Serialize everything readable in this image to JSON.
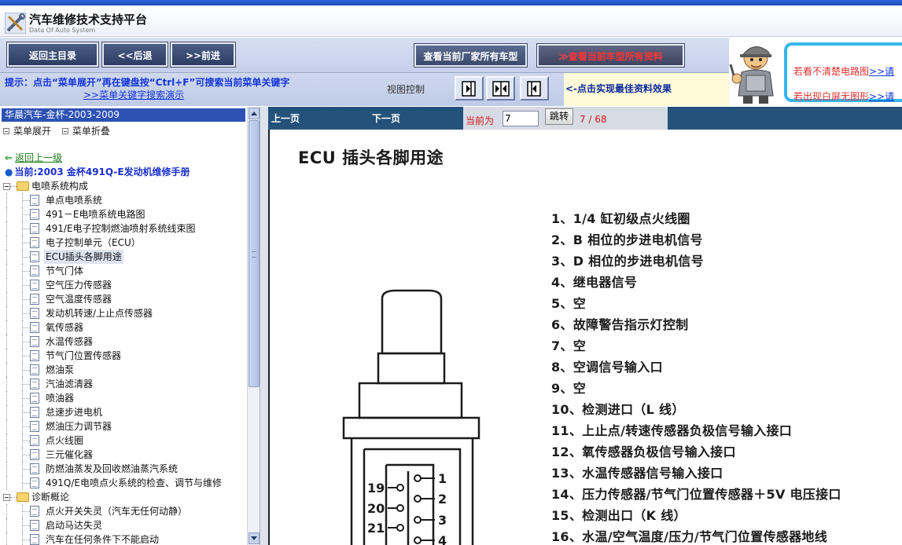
{
  "header": {
    "title": "汽车维修技术支持平台",
    "subtitle": "Data Of Auto System"
  },
  "toolbar": {
    "main_menu": "返回主目录",
    "back": "<<后退",
    "forward": ">>前进",
    "maker_models": "查看当前厂家所有车型",
    "model_data_arrow": "≫",
    "model_data": "查看当前车型所有资料"
  },
  "infobar": {
    "tip": "提示：点击“菜单展开”再在键盘按“Ctrl+F”可搜索当前菜单关键字",
    "tip_link": ">>菜单关键字搜索演示",
    "view_control": "视图控制",
    "best_effect": "<-点击实现最佳资料效果"
  },
  "help": {
    "line1": "若看不清楚电路图",
    "line1_link": ">>请",
    "line2": "若出现白屏无图形",
    "line2_link": ">>请"
  },
  "nav": {
    "tree_title": "华晨汽车-金杯-2003-2009",
    "expand": "菜单展开",
    "collapse": "菜单折叠",
    "back_up": "返回上一级",
    "current": "当前:2003 金杯491Q-E发动机维修手册",
    "groups": [
      {
        "label": "电喷系统构成",
        "items": [
          "单点电喷系统",
          "491－E电喷系统电路图",
          "491/E电子控制燃油喷射系统线束图",
          "电子控制单元（ECU）",
          "ECU插头各脚用途",
          "节气门体",
          "空气压力传感器",
          "空气温度传感器",
          "发动机转速/上止点传感器",
          "氧传感器",
          "水温传感器",
          "节气门位置传感器",
          "燃油泵",
          "汽油滤清器",
          "喷油器",
          "怠速步进电机",
          "燃油压力调节器",
          "点火线圈",
          "三元催化器",
          "防燃油蒸发及回收燃油蒸汽系统",
          "491Q/E电喷点火系统的检查、调节与维修"
        ]
      },
      {
        "label": "诊断概论",
        "items": [
          "点火开关失灵（汽车无任何动静）",
          "启动马达失灵",
          "汽车在任何条件下不能启动"
        ]
      }
    ],
    "selected_item": "ECU插头各脚用途"
  },
  "pager": {
    "prev": "上一页",
    "next": "下一页",
    "current_label": "当前为",
    "current_value": "7",
    "jump": "跳转",
    "count": "7 / 68"
  },
  "document": {
    "title": "ECU 插头各脚用途",
    "pins": [
      "1、1/4 缸初级点火线圈",
      "2、B 相位的步进电机信号",
      "3、D 相位的步进电机信号",
      "4、继电器信号",
      "5、空",
      "6、故障警告指示灯控制",
      "7、空",
      "8、空调信号输入口",
      "9、空",
      "10、检测进口（L 线）",
      "11、上止点/转速传感器负极信号输入接口",
      "12、氧传感器负极信号输入接口",
      "13、水温传感器信号输入接口",
      "14、压力传感器/节气门位置传感器＋5V 电压接口",
      "15、检测出口（K 线）",
      "16、水温/空气温度/压力/节气门位置传感器地线"
    ],
    "connector_labels": [
      "19",
      "20",
      "21",
      "1",
      "2",
      "3",
      "4"
    ]
  },
  "colors": {
    "nav_title_bg": "#2d52b4",
    "pager_bg": "#24527a",
    "tip_text": "#1436d8",
    "alert_red": "#d41818"
  }
}
